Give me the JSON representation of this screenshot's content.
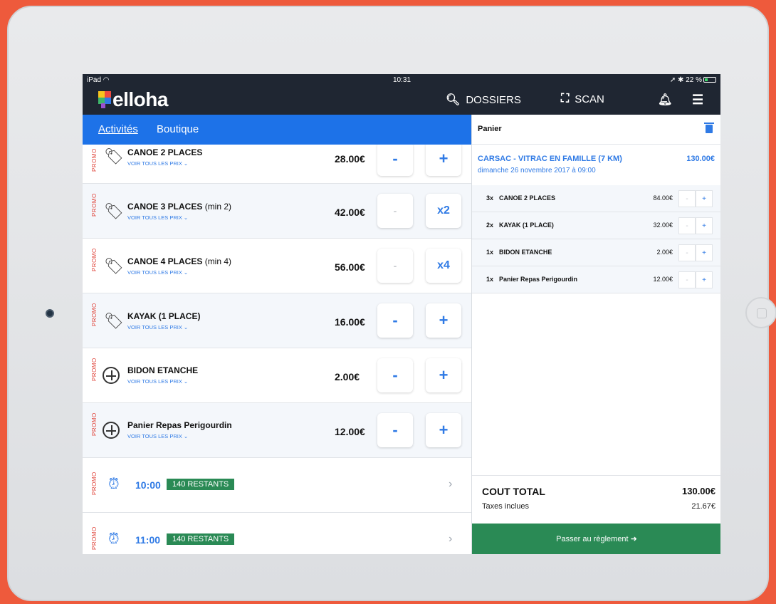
{
  "status": {
    "device": "iPad",
    "time": "10:31",
    "battery": "22 %"
  },
  "header": {
    "brand": "elloha",
    "dossiers": "DOSSIERS",
    "scan": "SCAN"
  },
  "tabs": [
    {
      "label": "Activités"
    },
    {
      "label": "Boutique"
    }
  ],
  "products": [
    {
      "promo": "PROMO",
      "name": "CANOE 2 PLACES",
      "min": "",
      "sub": "VOIR TOUS LES PRIX ⌄",
      "price": "28.00€",
      "left_btn": "-",
      "right_btn": "+"
    },
    {
      "promo": "PROMO",
      "name": "CANOE 3 PLACES",
      "min": " (min 2)",
      "sub": "VOIR TOUS LES PRIX ⌄",
      "price": "42.00€",
      "left_btn": "-",
      "right_btn": "x2"
    },
    {
      "promo": "PROMO",
      "name": "CANOE 4 PLACES",
      "min": " (min 4)",
      "sub": "VOIR TOUS LES PRIX ⌄",
      "price": "56.00€",
      "left_btn": "-",
      "right_btn": "x4"
    },
    {
      "promo": "PROMO",
      "name": "KAYAK (1 PLACE)",
      "min": "",
      "sub": "VOIR TOUS LES PRIX ⌄",
      "price": "16.00€",
      "left_btn": "-",
      "right_btn": "+"
    },
    {
      "promo": "PROMO",
      "name": "BIDON ETANCHE",
      "min": "",
      "sub": "VOIR TOUS LES PRIX ⌄",
      "price": "2.00€",
      "left_btn": "-",
      "right_btn": "+"
    },
    {
      "promo": "PROMO",
      "name": "Panier Repas Perigourdin",
      "min": "",
      "sub": "VOIR TOUS LES PRIX ⌄",
      "price": "12.00€",
      "left_btn": "-",
      "right_btn": "+"
    }
  ],
  "slots": [
    {
      "promo": "PROMO",
      "time": "10:00",
      "badge": "140 RESTANTS"
    },
    {
      "promo": "PROMO",
      "time": "11:00",
      "badge": "140 RESTANTS"
    }
  ],
  "cart": {
    "title": "Panier",
    "activity": "CARSAC - VITRAC EN FAMILLE (7 KM)",
    "activity_price": "130.00€",
    "activity_date": "dimanche 26 novembre 2017 à 09:00",
    "lines": [
      {
        "qty": "3x",
        "name": "CANOE 2 PLACES",
        "price": "84.00€"
      },
      {
        "qty": "2x",
        "name": "KAYAK (1 PLACE)",
        "price": "32.00€"
      },
      {
        "qty": "1x",
        "name": "BIDON ETANCHE",
        "price": "2.00€"
      },
      {
        "qty": "1x",
        "name": "Panier Repas Perigourdin",
        "price": "12.00€"
      }
    ],
    "minus": "-",
    "plus": "+",
    "total_label": "COUT TOTAL",
    "total": "130.00€",
    "tax_label": "Taxes inclues",
    "tax": "21.67€",
    "pay": "Passer au règlement ➜"
  },
  "colors": {
    "accent": "#1d72e8",
    "topbar": "#1f2632",
    "pay": "#2a8a55",
    "promo": "#e0443a"
  }
}
